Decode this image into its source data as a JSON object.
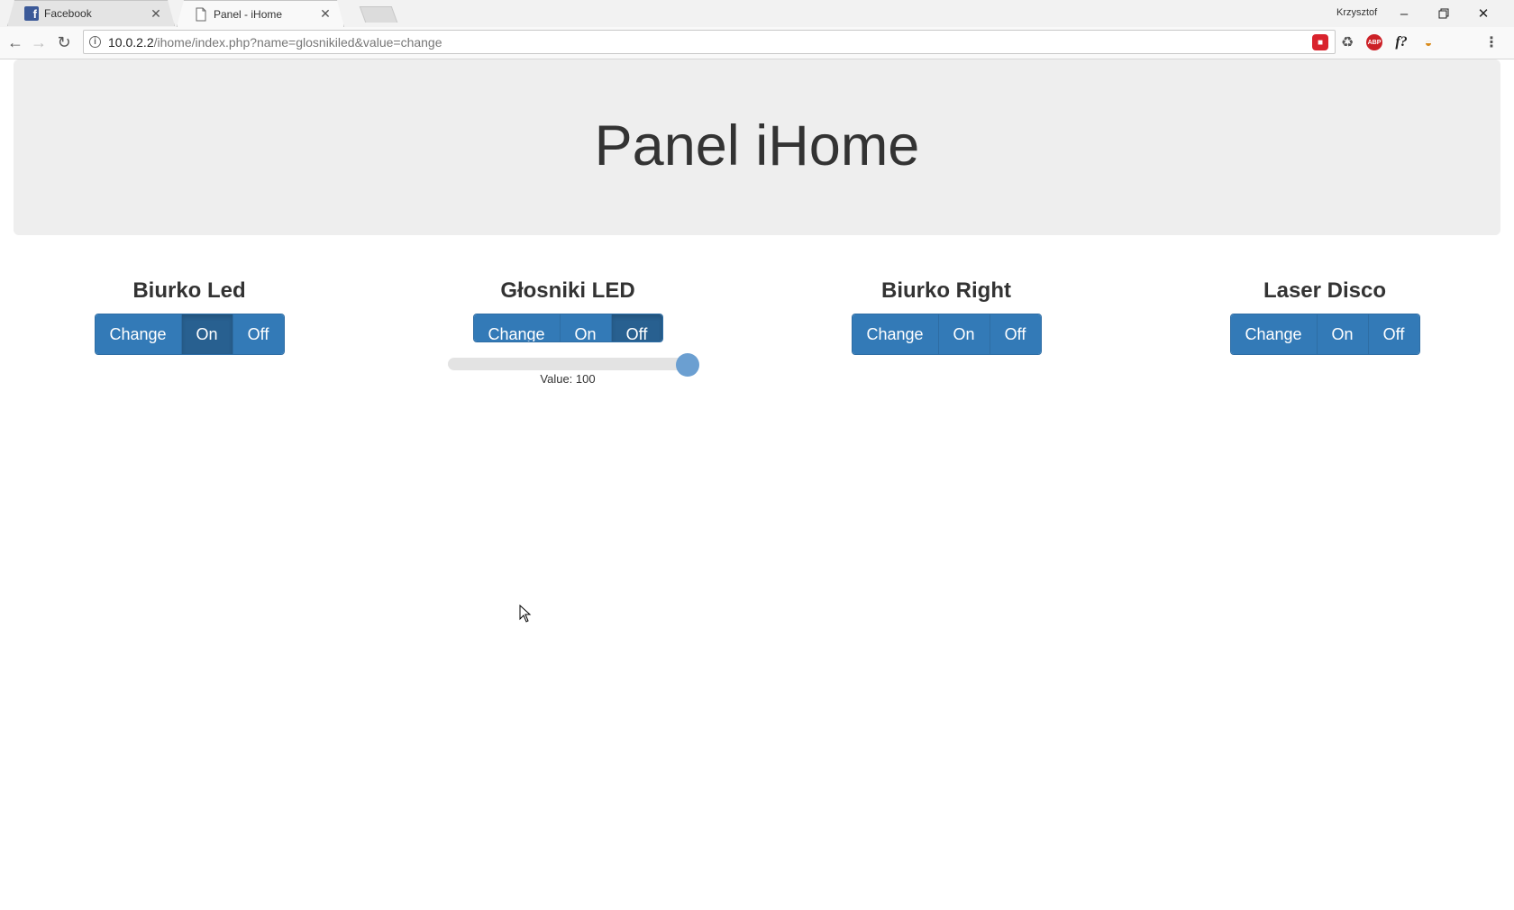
{
  "browser": {
    "tabs": [
      {
        "title": "Facebook",
        "icon": "facebook-icon",
        "active": false
      },
      {
        "title": "Panel - iHome",
        "icon": "page-icon",
        "active": true
      }
    ],
    "profile_name": "Krzysztof",
    "url_host": "10.0.2.2",
    "url_path": "/ihome/index.php?name=glosnikiled&value=change",
    "window_buttons": [
      "minimize-icon",
      "restore-icon",
      "close-icon"
    ]
  },
  "page": {
    "title": "Panel iHome",
    "devices": [
      {
        "name": "Biurko Led",
        "active": "on",
        "labels": {
          "change": "Change",
          "on": "On",
          "off": "Off"
        }
      },
      {
        "name": "Głosniki LED",
        "active": "off",
        "labels": {
          "change": "Change",
          "on": "On",
          "off": "Off"
        },
        "slider": {
          "value": 100,
          "min": 0,
          "max": 100,
          "caption": "Value: 100"
        }
      },
      {
        "name": "Biurko Right",
        "active": "none",
        "labels": {
          "change": "Change",
          "on": "On",
          "off": "Off"
        }
      },
      {
        "name": "Laser Disco",
        "active": "none",
        "labels": {
          "change": "Change",
          "on": "On",
          "off": "Off"
        }
      }
    ]
  },
  "colors": {
    "primary": "#337ab7",
    "primary_active": "#286090",
    "jumbotron_bg": "#eeeeee",
    "slider_thumb": "#6b9fd1"
  }
}
